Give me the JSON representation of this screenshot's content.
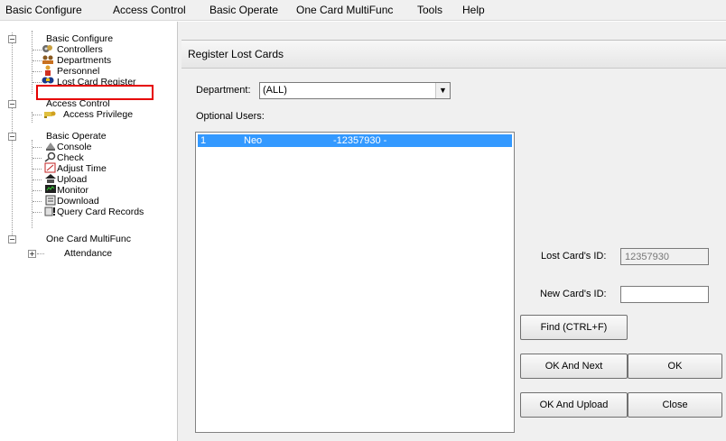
{
  "menu": {
    "items": [
      "Basic Configure",
      "Access Control",
      "Basic Operate",
      "One Card MultiFunc",
      "Tools",
      "Help"
    ]
  },
  "tree": {
    "basic_configure": "Basic Configure",
    "controllers": "Controllers",
    "departments": "Departments",
    "personnel": "Personnel",
    "lost_card_register": "Lost Card Register",
    "access_control": "Access Control",
    "access_privilege": "Access Privilege",
    "basic_operate": "Basic Operate",
    "console": "Console",
    "check": "Check",
    "adjust_time": "Adjust Time",
    "upload": "Upload",
    "monitor": "Monitor",
    "download": "Download",
    "query_card_records": "Query Card Records",
    "one_card_multifunc": "One Card MultiFunc",
    "attendance": "Attendance"
  },
  "dialog": {
    "title": "Register Lost Cards",
    "department_label": "Department:",
    "department_value": "(ALL)",
    "optional_users_label": "Optional Users:",
    "users": [
      {
        "no": "1",
        "name": "Neo",
        "card": "-12357930 -"
      }
    ],
    "lost_card_id_label": "Lost Card's ID:",
    "lost_card_id_value": "12357930",
    "new_card_id_label": "New Card's ID:",
    "new_card_id_value": "",
    "find_button": "Find  (CTRL+F)",
    "ok_and_next_button": "OK And Next",
    "ok_button": "OK",
    "ok_and_upload_button": "OK And Upload",
    "close_button": "Close"
  }
}
